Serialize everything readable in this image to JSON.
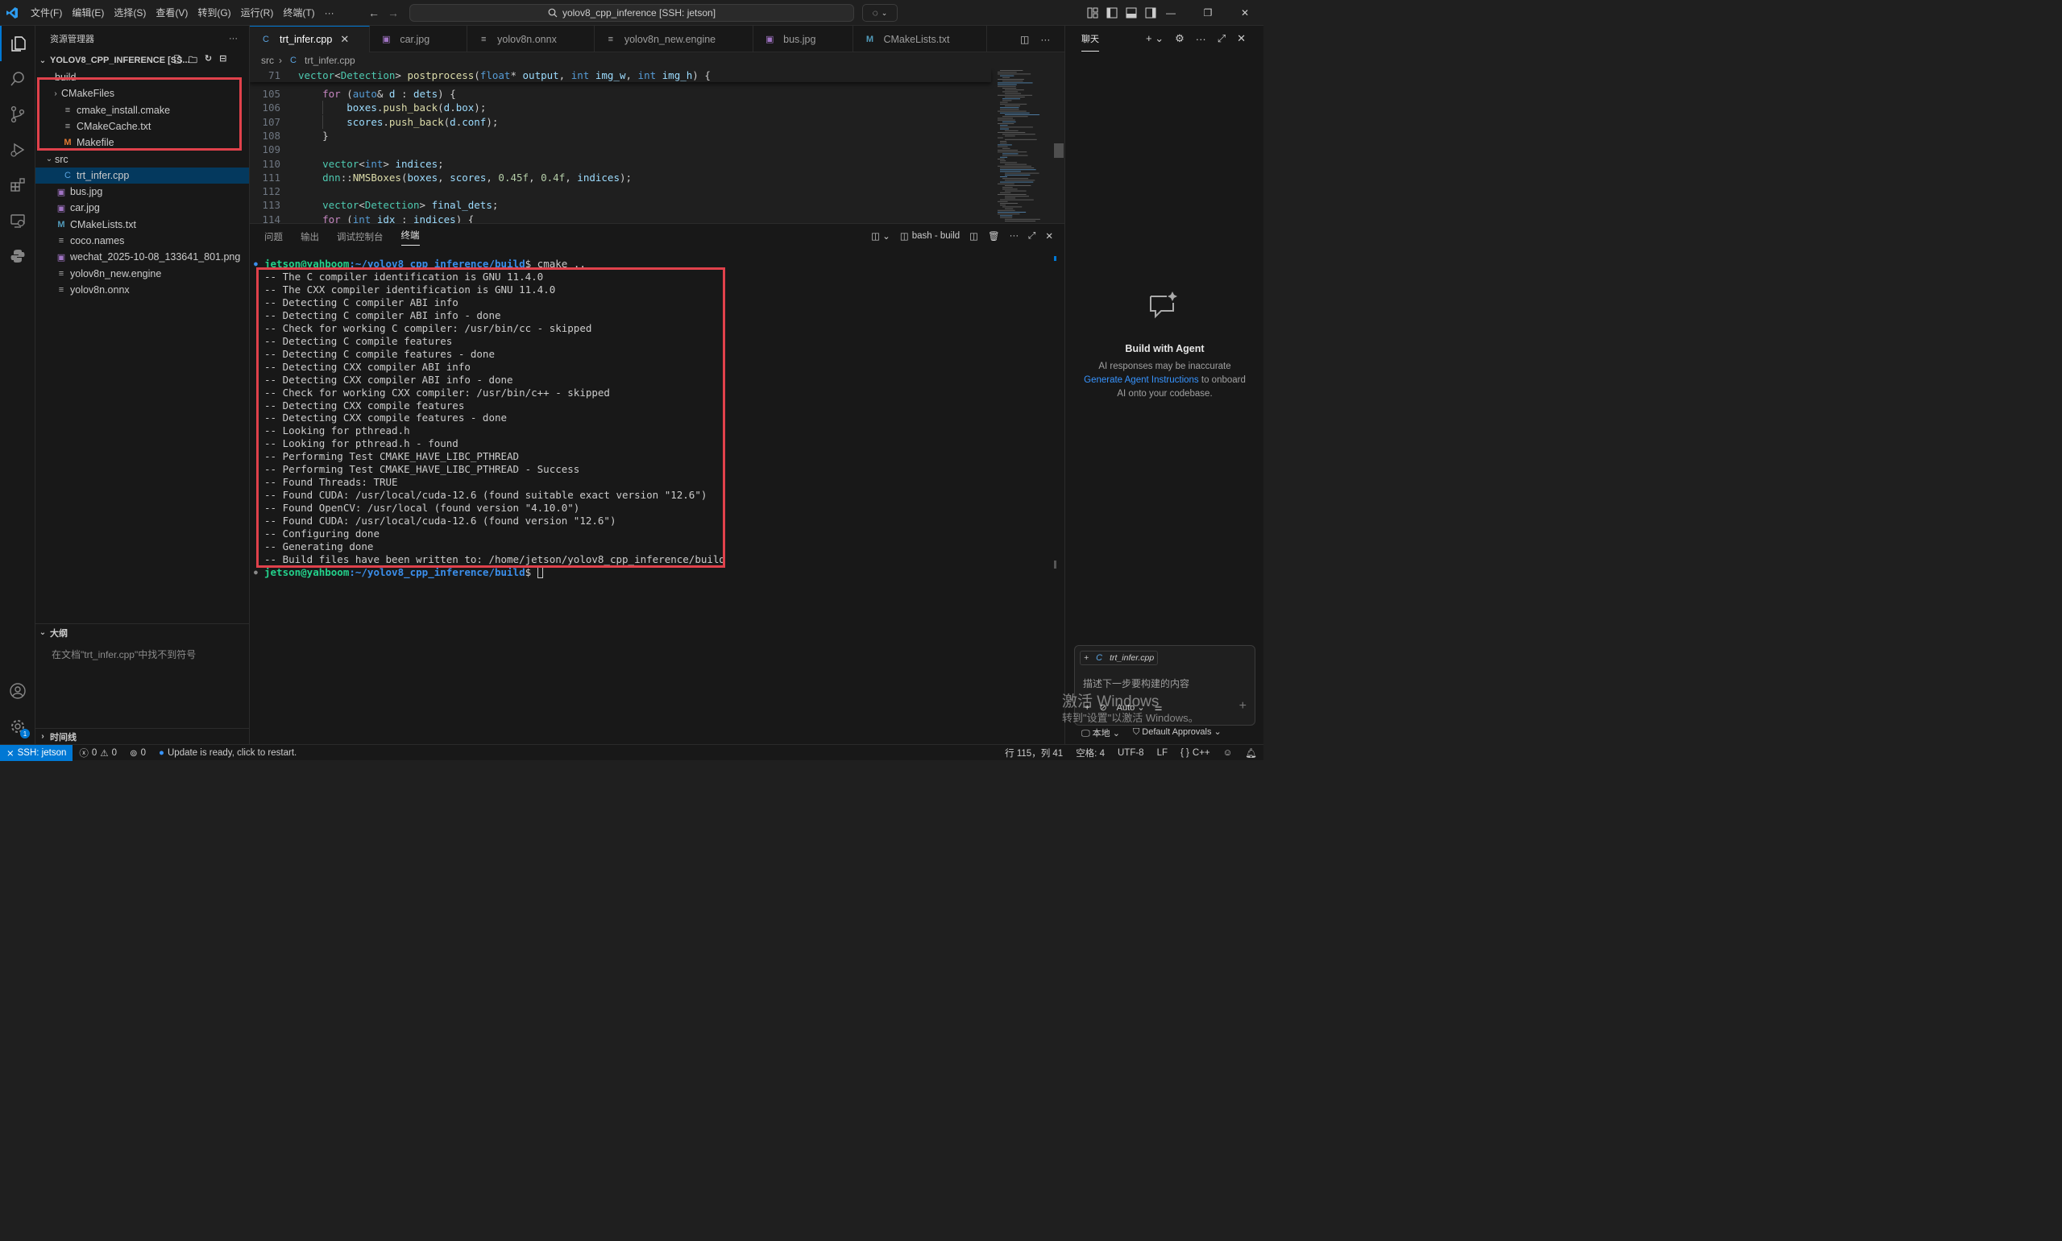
{
  "titlebar": {
    "menus": [
      "文件(F)",
      "编辑(E)",
      "选择(S)",
      "查看(V)",
      "转到(G)",
      "运行(R)",
      "终端(T)",
      "···"
    ],
    "search_text": "yolov8_cpp_inference [SSH: jetson]"
  },
  "explorer": {
    "title": "资源管理器",
    "more": "···",
    "root": "YOLOV8_CPP_INFERENCE [SS...",
    "tree": [
      {
        "label": "build",
        "indent": 0,
        "tw": "⌄",
        "icon": ""
      },
      {
        "label": "CMakeFiles",
        "indent": 1,
        "tw": "›",
        "icon": ""
      },
      {
        "label": "cmake_install.cmake",
        "indent": 1,
        "tw": "",
        "icon": "lines"
      },
      {
        "label": "CMakeCache.txt",
        "indent": 1,
        "tw": "",
        "icon": "lines"
      },
      {
        "label": "Makefile",
        "indent": 1,
        "tw": "",
        "icon": "mk"
      },
      {
        "label": "src",
        "indent": 0,
        "tw": "⌄",
        "icon": ""
      },
      {
        "label": "trt_infer.cpp",
        "indent": 1,
        "tw": "",
        "icon": "cpp"
      },
      {
        "label": "bus.jpg",
        "indent": 0,
        "tw": "",
        "icon": "img"
      },
      {
        "label": "car.jpg",
        "indent": 0,
        "tw": "",
        "icon": "img"
      },
      {
        "label": "CMakeLists.txt",
        "indent": 0,
        "tw": "",
        "icon": "m"
      },
      {
        "label": "coco.names",
        "indent": 0,
        "tw": "",
        "icon": "lines"
      },
      {
        "label": "wechat_2025-10-08_133641_801.png",
        "indent": 0,
        "tw": "",
        "icon": "img"
      },
      {
        "label": "yolov8n_new.engine",
        "indent": 0,
        "tw": "",
        "icon": "lines"
      },
      {
        "label": "yolov8n.onnx",
        "indent": 0,
        "tw": "",
        "icon": "lines"
      }
    ],
    "outline_title": "大纲",
    "outline_empty": "在文档\"trt_infer.cpp\"中找不到符号",
    "timeline_title": "时间线"
  },
  "tabs": [
    {
      "label": "trt_infer.cpp",
      "icon": "cpp",
      "active": true
    },
    {
      "label": "car.jpg",
      "icon": "img",
      "active": false
    },
    {
      "label": "yolov8n.onnx",
      "icon": "lines",
      "active": false
    },
    {
      "label": "yolov8n_new.engine",
      "icon": "lines",
      "active": false
    },
    {
      "label": "bus.jpg",
      "icon": "img",
      "active": false
    },
    {
      "label": "CMakeLists.txt",
      "icon": "m",
      "active": false
    }
  ],
  "breadcrumb": {
    "folder": "src",
    "file": "trt_infer.cpp"
  },
  "code": {
    "sticky_line": "71",
    "sticky_text": "vector<Detection> postprocess(float* output, int img_w, int img_h) {",
    "lines": [
      {
        "n": "105",
        "t": "    for (auto& d : dets) {"
      },
      {
        "n": "106",
        "t": "        boxes.push_back(d.box);"
      },
      {
        "n": "107",
        "t": "        scores.push_back(d.conf);"
      },
      {
        "n": "108",
        "t": "    }"
      },
      {
        "n": "109",
        "t": ""
      },
      {
        "n": "110",
        "t": "    vector<int> indices;"
      },
      {
        "n": "111",
        "t": "    dnn::NMSBoxes(boxes, scores, 0.45f, 0.4f, indices);"
      },
      {
        "n": "112",
        "t": ""
      },
      {
        "n": "113",
        "t": "    vector<Detection> final_dets;"
      },
      {
        "n": "114",
        "t": "    for (int idx : indices) {"
      }
    ]
  },
  "panel": {
    "tabs": [
      "问题",
      "输出",
      "调试控制台",
      "终端"
    ],
    "active_tab": "终端",
    "terminal_name": "bash - build",
    "prompt_user": "jetson@yahboom",
    "prompt_path": ":~/yolov8_cpp_inference/build",
    "prompt_suffix": "$ ",
    "command": "cmake ..",
    "output": [
      "-- The C compiler identification is GNU 11.4.0",
      "-- The CXX compiler identification is GNU 11.4.0",
      "-- Detecting C compiler ABI info",
      "-- Detecting C compiler ABI info - done",
      "-- Check for working C compiler: /usr/bin/cc - skipped",
      "-- Detecting C compile features",
      "-- Detecting C compile features - done",
      "-- Detecting CXX compiler ABI info",
      "-- Detecting CXX compiler ABI info - done",
      "-- Check for working CXX compiler: /usr/bin/c++ - skipped",
      "-- Detecting CXX compile features",
      "-- Detecting CXX compile features - done",
      "-- Looking for pthread.h",
      "-- Looking for pthread.h - found",
      "-- Performing Test CMAKE_HAVE_LIBC_PTHREAD",
      "-- Performing Test CMAKE_HAVE_LIBC_PTHREAD - Success",
      "-- Found Threads: TRUE",
      "-- Found CUDA: /usr/local/cuda-12.6 (found suitable exact version \"12.6\")",
      "-- Found OpenCV: /usr/local (found version \"4.10.0\")",
      "-- Found CUDA: /usr/local/cuda-12.6 (found version \"12.6\")",
      "-- Configuring done",
      "-- Generating done",
      "-- Build files have been written to: /home/jetson/yolov8_cpp_inference/build"
    ]
  },
  "chat": {
    "title": "聊天",
    "heading": "Build with Agent",
    "line1": "AI responses may be inaccurate",
    "link": "Generate Agent Instructions",
    "line2_rest": " to onboard",
    "line3": "AI onto your codebase.",
    "context_file": "trt_infer.cpp",
    "input_placeholder": "描述下一步要构建的内容",
    "mode": "Auto",
    "location": "本地",
    "approvals": "Default Approvals",
    "watermark_1": "激活 Windows",
    "watermark_2": "转到\"设置\"以激活 Windows。"
  },
  "statusbar": {
    "remote": "SSH: jetson",
    "errors": "0",
    "warnings": "0",
    "ports": "0",
    "update": "Update is ready, click to restart.",
    "position": "行 115，列 41",
    "spaces": "空格: 4",
    "encoding": "UTF-8",
    "eol": "LF",
    "language": "C++"
  },
  "colors": {
    "accent": "#0078d4",
    "highlight_box": "#e0414b",
    "prompt_user": "#23d18b",
    "prompt_path": "#3b8eea"
  }
}
